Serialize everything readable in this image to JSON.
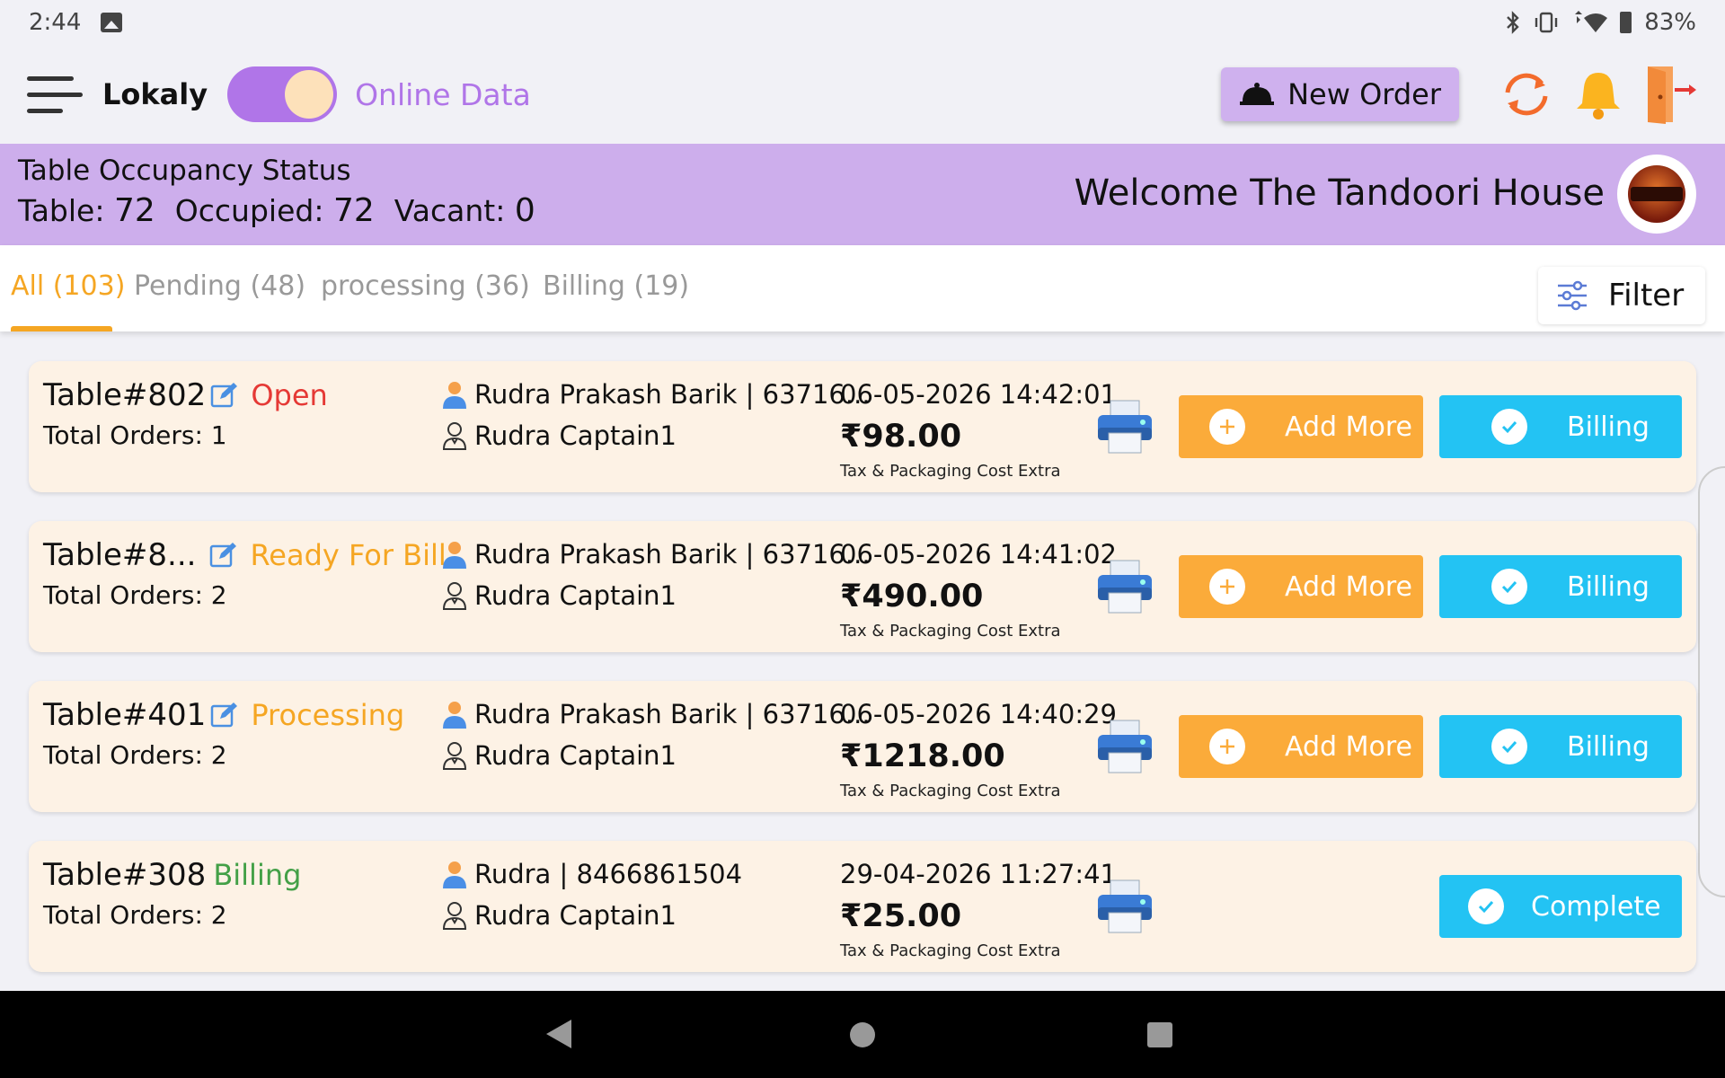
{
  "status_bar": {
    "time": "2:44",
    "battery": "83%",
    "icons": [
      "image-icon",
      "bluetooth-icon",
      "vibrate-icon",
      "wifi-icon",
      "battery-icon"
    ]
  },
  "header": {
    "brand": "Lokaly",
    "toggle_label": "Online Data",
    "toggle_on": true,
    "new_order_label": "New Order",
    "icons": [
      "menu-icon",
      "cloche-icon",
      "sync-icon",
      "bell-icon",
      "logout-icon"
    ]
  },
  "occupancy": {
    "title": "Table Occupancy Status",
    "table_label": "Table:",
    "table_count": "72",
    "occupied_label": "Occupied:",
    "occupied_count": "72",
    "vacant_label": "Vacant:",
    "vacant_count": "0",
    "welcome": "Welcome The Tandoori House"
  },
  "tabs": [
    {
      "label": "All (103)",
      "active": true
    },
    {
      "label": "Pending (48)",
      "active": false
    },
    {
      "label": "processing (36)",
      "active": false
    },
    {
      "label": "Billing (19)",
      "active": false
    }
  ],
  "filter_label": "Filter",
  "orders": [
    {
      "table": "Table#802",
      "status": "Open",
      "total_orders": "Total Orders: 1",
      "customer": "Rudra Prakash Barik | 63716...",
      "captain": "Rudra Captain1",
      "datetime": "06-05-2026 14:42:01",
      "amount": "₹98.00",
      "tax_note": "Tax & Packaging Cost Extra",
      "add_more_label": "Add More",
      "action_label": "Billing"
    },
    {
      "table": "Table#8...",
      "status": "Ready For Bill",
      "total_orders": "Total Orders: 2",
      "customer": "Rudra Prakash Barik | 63716...",
      "captain": "Rudra Captain1",
      "datetime": "06-05-2026 14:41:02",
      "amount": "₹490.00",
      "tax_note": "Tax & Packaging Cost Extra",
      "add_more_label": "Add More",
      "action_label": "Billing"
    },
    {
      "table": "Table#401",
      "status": "Processing",
      "total_orders": "Total Orders: 2",
      "customer": "Rudra Prakash Barik | 63716...",
      "captain": "Rudra Captain1",
      "datetime": "06-05-2026 14:40:29",
      "amount": "₹1218.00",
      "tax_note": "Tax & Packaging Cost Extra",
      "add_more_label": "Add More",
      "action_label": "Billing"
    },
    {
      "table": "Table#308",
      "status": "Billing",
      "total_orders": "Total Orders: 2",
      "customer": "Rudra | 8466861504",
      "captain": "Rudra Captain1",
      "datetime": "29-04-2026 11:27:41",
      "amount": "₹25.00",
      "tax_note": "Tax & Packaging Cost Extra",
      "action_label": "Complete"
    }
  ],
  "colors": {
    "accent_purple": "#b075e8",
    "banner_purple": "#cdaeec",
    "orange": "#f5a623",
    "add_more_orange": "#fbab3a",
    "billing_blue": "#23c3f3",
    "status_open": "#e53935",
    "status_billing": "#43a047",
    "card_bg": "#fdf2e5"
  }
}
